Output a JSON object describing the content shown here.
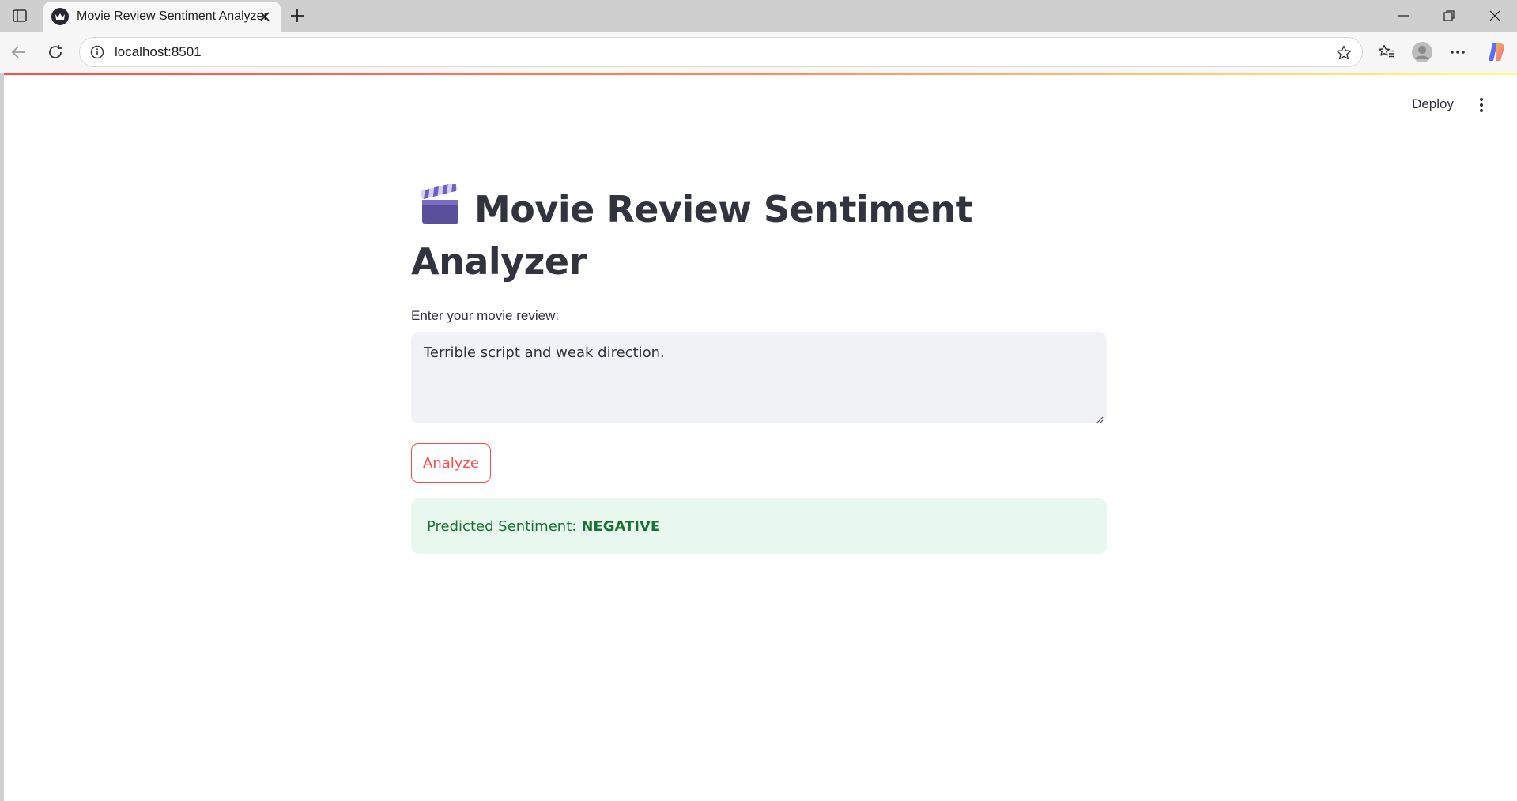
{
  "browser": {
    "tab_title": "Movie Review Sentiment Analyzer",
    "url": "localhost:8501"
  },
  "app": {
    "deploy_label": "Deploy",
    "title": "Movie Review Sentiment Analyzer",
    "title_icon": "clapper-board-icon",
    "input_label": "Enter your movie review:",
    "input_value": "Terrible script and weak direction.",
    "analyze_label": "Analyze",
    "result_prefix": "Predicted Sentiment:",
    "result_value": "NEGATIVE"
  },
  "colors": {
    "accent": "#ff4b4b",
    "text": "#31333f",
    "input_bg": "#f0f2f6",
    "success_bg": "#e8f8ee",
    "success_text": "#177233"
  }
}
